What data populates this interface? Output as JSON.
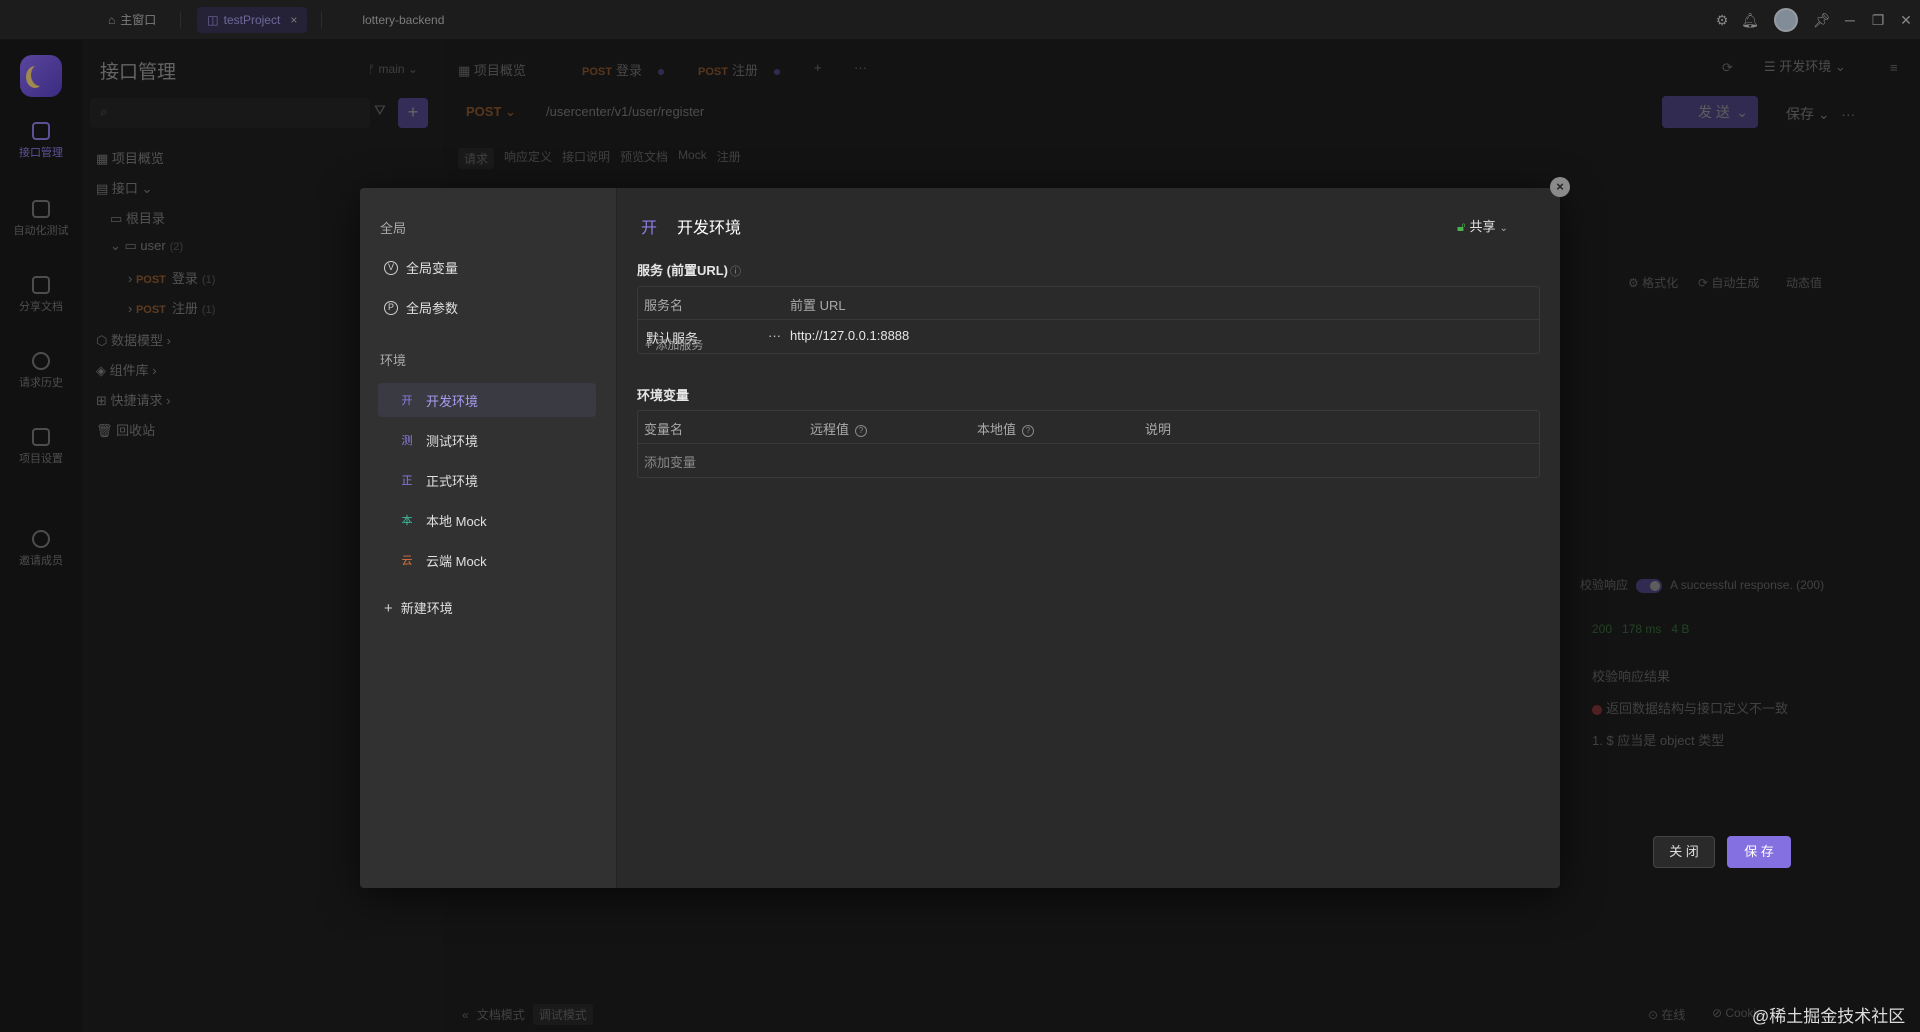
{
  "titlebar": {
    "home_label": "主窗口",
    "active_tab": "testProject",
    "active_tab_close": "×",
    "other_tab": "lottery-backend"
  },
  "leftnav": {
    "items": [
      {
        "label": "接口管理",
        "active": true
      },
      {
        "label": "自动化测试"
      },
      {
        "label": "分享文档"
      },
      {
        "label": "请求历史"
      },
      {
        "label": "项目设置"
      },
      {
        "label": "邀请成员"
      }
    ]
  },
  "tree": {
    "title": "接口管理",
    "branch": "main",
    "add": "+",
    "rows": [
      {
        "label": "项目概览"
      },
      {
        "label": "接口"
      },
      {
        "label": "根目录"
      },
      {
        "label": "user",
        "count": "(2)"
      },
      {
        "method": "POST",
        "label": "登录",
        "count": "(1)"
      },
      {
        "method": "POST",
        "label": "注册",
        "count": "(1)"
      },
      {
        "label": "数据模型"
      },
      {
        "label": "组件库"
      },
      {
        "label": "快捷请求"
      },
      {
        "label": "回收站"
      }
    ]
  },
  "main": {
    "tabs": [
      {
        "label": "项目概览"
      },
      {
        "method": "POST",
        "label": "登录"
      },
      {
        "method": "POST",
        "label": "注册"
      }
    ],
    "env_selector": "开发环境",
    "method": "POST",
    "path": "/usercenter/v1/user/register",
    "send": "发 送",
    "save": "保存",
    "subtabs": [
      "请求",
      "响应定义",
      "接口说明",
      "预览文档",
      "Mock",
      "注册"
    ],
    "format": "格式化",
    "auto_gen": "自动生成",
    "dynamic_value": "动态值",
    "validate_label": "校验响应",
    "response_desc": "A successful response. (200)",
    "status": "200",
    "time": "178 ms",
    "size": "4 B",
    "validate_result_title": "校验响应结果",
    "validate_error": "返回数据结构与接口定义不一致",
    "validate_detail": "1. $ 应当是 object 类型",
    "mode_doc": "文档模式",
    "mode_debug": "调试模式",
    "online": "在线",
    "cookie": "Cookie"
  },
  "modal": {
    "global_label": "全局",
    "global_vars": "全局变量",
    "global_vars_icon": "V",
    "global_params": "全局参数",
    "global_params_icon": "P",
    "env_label": "环境",
    "envs": [
      {
        "badge": "开",
        "name": "开发环境",
        "color": "#8d7fe6",
        "active": true
      },
      {
        "badge": "测",
        "name": "测试环境",
        "color": "#8d7fe6"
      },
      {
        "badge": "正",
        "name": "正式环境",
        "color": "#8d7fe6"
      },
      {
        "badge": "本",
        "name": "本地 Mock",
        "color": "#3fb99a"
      },
      {
        "badge": "云",
        "name": "云端 Mock",
        "color": "#e0703c"
      }
    ],
    "new_env": "新建环境",
    "current_badge": "开",
    "current_title": "开发环境",
    "share": "共享",
    "services_title": "服务 (前置URL)",
    "services_cols": [
      "服务名",
      "前置 URL"
    ],
    "services_rows": [
      {
        "name": "默认服务",
        "more": "···",
        "url": "http://127.0.0.1:8888"
      }
    ],
    "add_service": "+ 添加服务",
    "vars_title": "环境变量",
    "vars_cols": [
      "变量名",
      "远程值",
      "本地值",
      "说明"
    ],
    "add_var": "添加变量",
    "close_btn": "关 闭",
    "save_btn": "保 存",
    "modal_close_icon": "×"
  },
  "watermark": "@稀土掘金技术社区"
}
